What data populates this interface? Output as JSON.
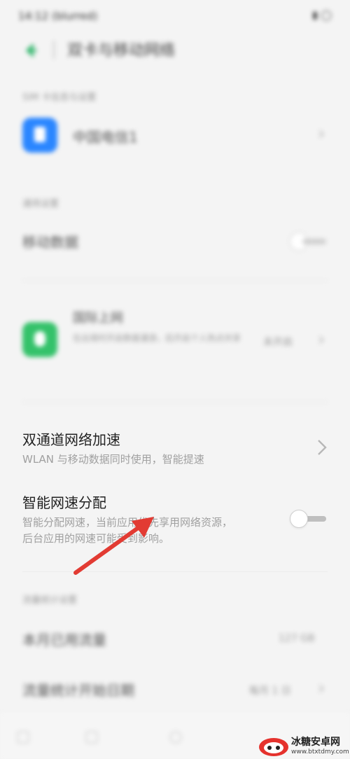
{
  "status_bar": {
    "time": "14:12 (blurred)",
    "right": "battery"
  },
  "header": {
    "title": "双卡与移动网络"
  },
  "sim_section": {
    "label": "SIM 卡信息与设置",
    "carrier": "中国电信1",
    "icon": "sim-card-icon",
    "icon_color": "#2a86ff"
  },
  "general_section": {
    "label": "通用设置",
    "mobile_data": {
      "label": "移动数据"
    }
  },
  "roaming": {
    "title": "国际上网",
    "desc": "在出境时开启数据漫游，后开启个人热点共享",
    "status": "未开启",
    "icon_color": "#34c26a"
  },
  "dual_channel": {
    "title": "双通道网络加速",
    "subtitle": "WLAN 与移动数据同时使用，智能提速"
  },
  "smart_speed": {
    "title": "智能网速分配",
    "subtitle_line1": "智能分配网速，当前应用优先享用网络资源，",
    "subtitle_line2": "后台应用的网速可能受到影响。",
    "enabled": false
  },
  "usage_section": {
    "label": "流量统计设置",
    "this_month": {
      "label": "本月已用流量",
      "value": "127 GB"
    },
    "cycle": {
      "label": "流量统计开始日期",
      "value": "每月 1 日"
    }
  },
  "arrow_color": "#e23b33",
  "watermark": {
    "name": "冰糖安卓网",
    "url": "www.btxtdmy.com"
  }
}
